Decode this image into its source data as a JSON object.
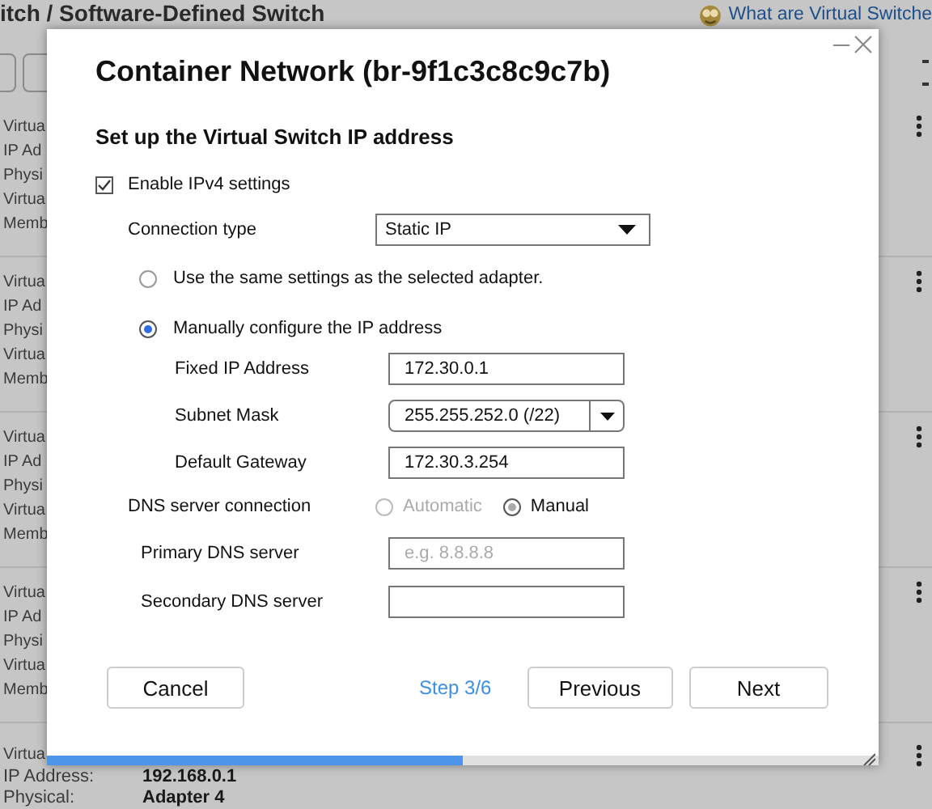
{
  "background": {
    "title": "itch / Software-Defined Switch",
    "help_link": "What are Virtual Switche",
    "groups": [
      {
        "lines": [
          {
            "label": "Virtua"
          },
          {
            "label": "IP Ad"
          },
          {
            "label": "Physi"
          },
          {
            "label": "Virtua"
          },
          {
            "label": "Memb"
          }
        ]
      },
      {
        "lines": [
          {
            "label": "Virtua"
          },
          {
            "label": "IP Ad"
          },
          {
            "label": "Physi"
          },
          {
            "label": "Virtua"
          },
          {
            "label": "Memb"
          }
        ]
      },
      {
        "lines": [
          {
            "label": "Virtua"
          },
          {
            "label": "IP Ad"
          },
          {
            "label": "Physi"
          },
          {
            "label": "Virtua"
          },
          {
            "label": "Memb"
          }
        ]
      },
      {
        "lines": [
          {
            "label": "Virtua"
          },
          {
            "label": "IP Ad"
          },
          {
            "label": "Physi"
          },
          {
            "label": "Virtua"
          },
          {
            "label": "Memb"
          }
        ]
      },
      {
        "lines": [
          {
            "label": "Virtua"
          },
          {
            "label": "IP Address:",
            "value": "192.168.0.1"
          },
          {
            "label": "Physical:",
            "value": "Adapter 4"
          }
        ]
      }
    ]
  },
  "dialog": {
    "title": "Container Network (br-9f1c3c8c9c7b)",
    "section": "Set up the Virtual Switch IP address",
    "enable_ipv4": {
      "label": "Enable IPv4 settings",
      "checked": true
    },
    "connection_type": {
      "label": "Connection type",
      "value": "Static IP"
    },
    "ip_modes": [
      {
        "label": "Use the same settings as the selected adapter.",
        "selected": false
      },
      {
        "label": "Manually configure the IP address",
        "selected": true
      }
    ],
    "fields": [
      {
        "label": "Fixed IP Address",
        "value": "172.30.0.1",
        "kind": "text"
      },
      {
        "label": "Subnet Mask",
        "value": "255.255.252.0 (/22)",
        "kind": "select"
      },
      {
        "label": "Default Gateway",
        "value": "172.30.3.254",
        "kind": "text"
      }
    ],
    "dns_connection": {
      "label": "DNS server connection",
      "options": [
        {
          "label": "Automatic",
          "selected": false,
          "disabled": true
        },
        {
          "label": "Manual",
          "selected": true,
          "disabled": false
        }
      ]
    },
    "dns_fields": [
      {
        "label": "Primary DNS server",
        "placeholder": "e.g. 8.8.8.8"
      },
      {
        "label": "Secondary DNS server"
      }
    ],
    "buttons": {
      "cancel": "Cancel",
      "previous": "Previous",
      "next": "Next"
    },
    "step": "Step 3/6",
    "progress": {
      "level": 0.5
    }
  }
}
